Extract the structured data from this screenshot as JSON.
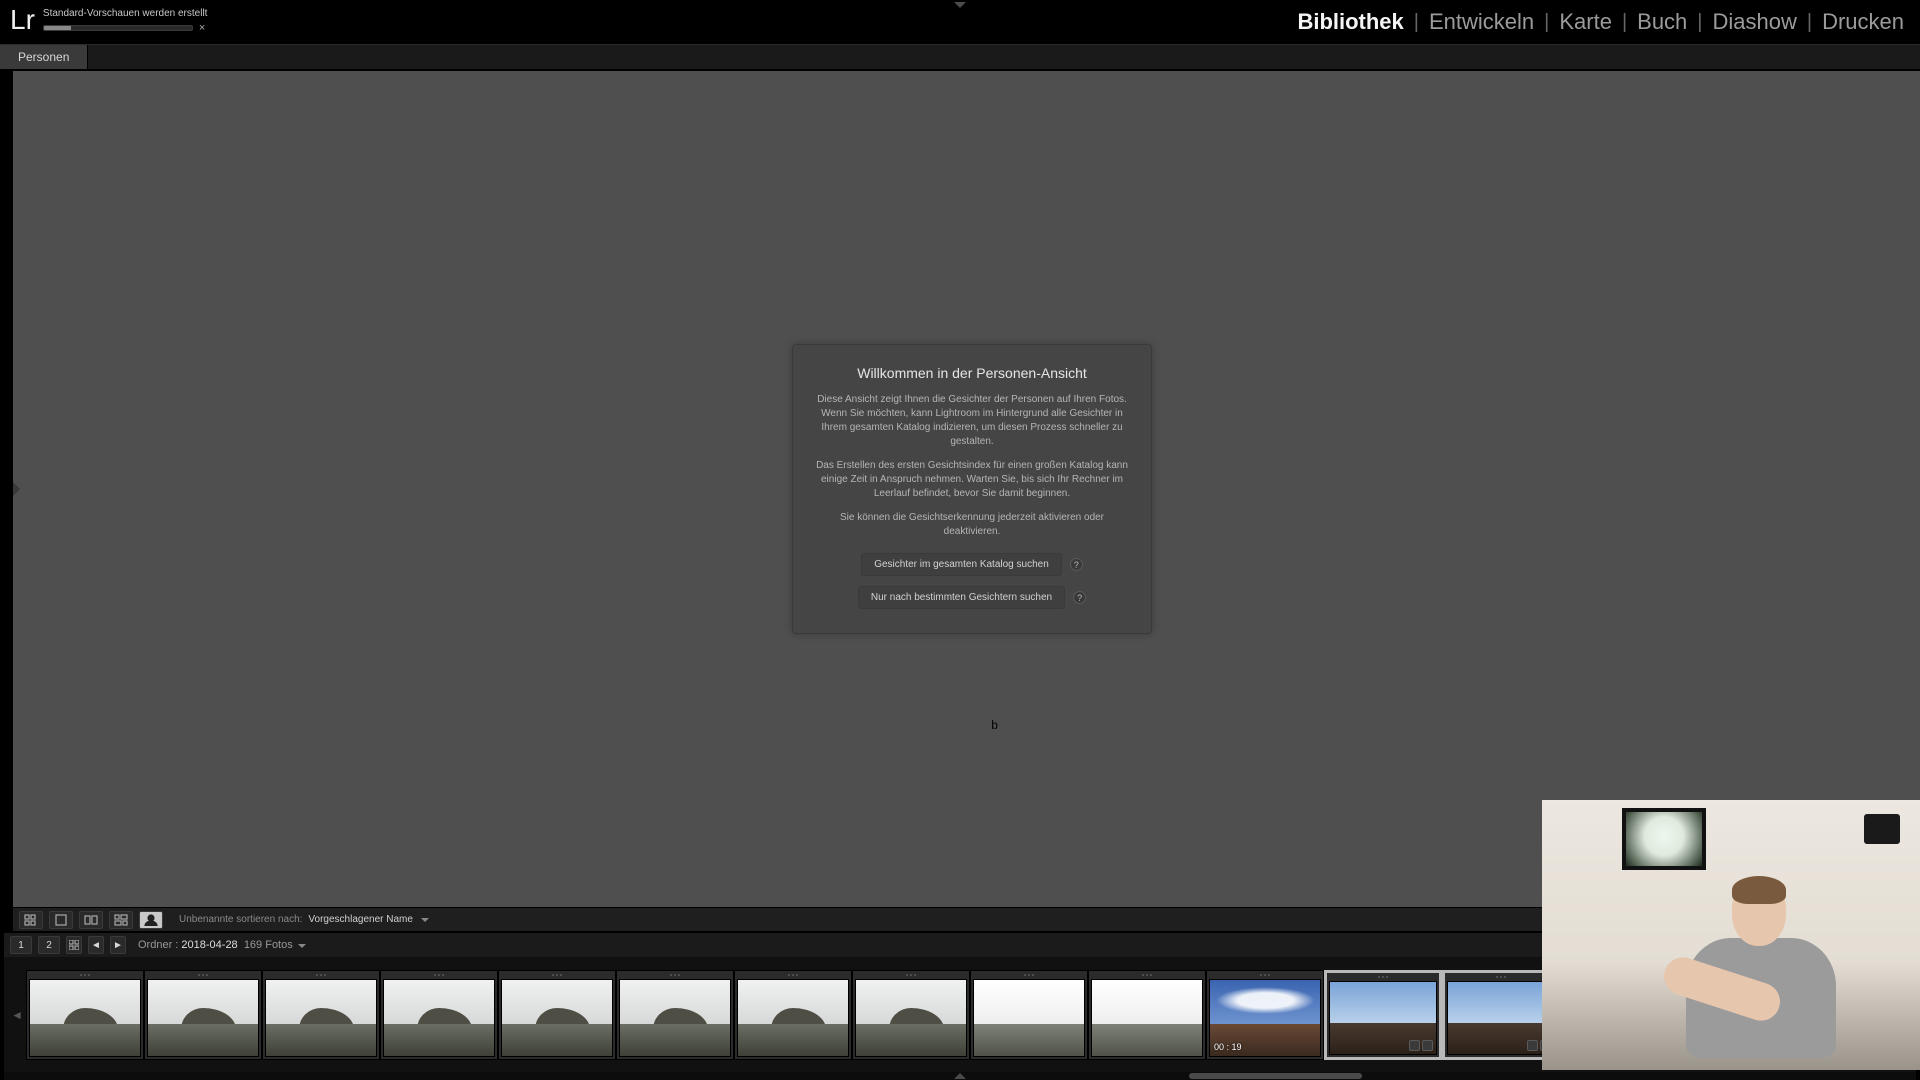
{
  "app": {
    "logo": "Lr"
  },
  "progress": {
    "label": "Standard-Vorschauen werden erstellt",
    "close": "×"
  },
  "modules": {
    "bibliothek": "Bibliothek",
    "entwickeln": "Entwickeln",
    "karte": "Karte",
    "buch": "Buch",
    "diashow": "Diashow",
    "drucken": "Drucken"
  },
  "view_tab": {
    "personen": "Personen"
  },
  "welcome": {
    "title": "Willkommen in der Personen-Ansicht",
    "p1": "Diese Ansicht zeigt Ihnen die Gesichter der Personen auf Ihren Fotos. Wenn Sie möchten, kann Lightroom im Hintergrund alle Gesichter in Ihrem gesamten Katalog indizieren, um diesen Prozess schneller zu gestalten.",
    "p2": "Das Erstellen des ersten Gesichtsindex für einen großen Katalog kann einige Zeit in Anspruch nehmen. Warten Sie, bis sich Ihr Rechner im Leerlauf befindet, bevor Sie damit beginnen.",
    "p3": "Sie können die Gesichtserkennung jederzeit aktivieren oder deaktivieren.",
    "btn_all": "Gesichter im gesamten Katalog suchen",
    "btn_selected": "Nur nach bestimmten Gesichtern suchen",
    "help": "?"
  },
  "toolbar": {
    "sort_label": "Unbenannte sortieren nach:",
    "sort_value": "Vorgeschlagener Name"
  },
  "filmstrip": {
    "second_monitor": "1",
    "second_monitor2": "2",
    "path_prefix": "Ordner : ",
    "path_folder": "2018-04-28",
    "count": "169 Fotos",
    "video_time": "00 : 19",
    "scroll_left_pct": 62,
    "scroll_width_pct": 9,
    "thumbs": [
      {
        "style": "a",
        "sel": false
      },
      {
        "style": "a",
        "sel": false
      },
      {
        "style": "a",
        "sel": false
      },
      {
        "style": "a",
        "sel": false
      },
      {
        "style": "a",
        "sel": false
      },
      {
        "style": "a",
        "sel": false
      },
      {
        "style": "a",
        "sel": false
      },
      {
        "style": "a",
        "sel": false
      },
      {
        "style": "b",
        "sel": false
      },
      {
        "style": "b",
        "sel": false
      },
      {
        "style": "c",
        "sel": false,
        "video": true
      },
      {
        "style": "d",
        "sel": true,
        "badges": 2
      },
      {
        "style": "d",
        "sel": true,
        "badges": 2
      },
      {
        "style": "e",
        "sel": false,
        "badges": 2
      },
      {
        "style": "e",
        "sel": false,
        "badges": 2
      },
      {
        "style": "e",
        "sel": false,
        "badges": 2
      },
      {
        "style": "e",
        "sel": false
      }
    ]
  },
  "cursor_char": "b"
}
